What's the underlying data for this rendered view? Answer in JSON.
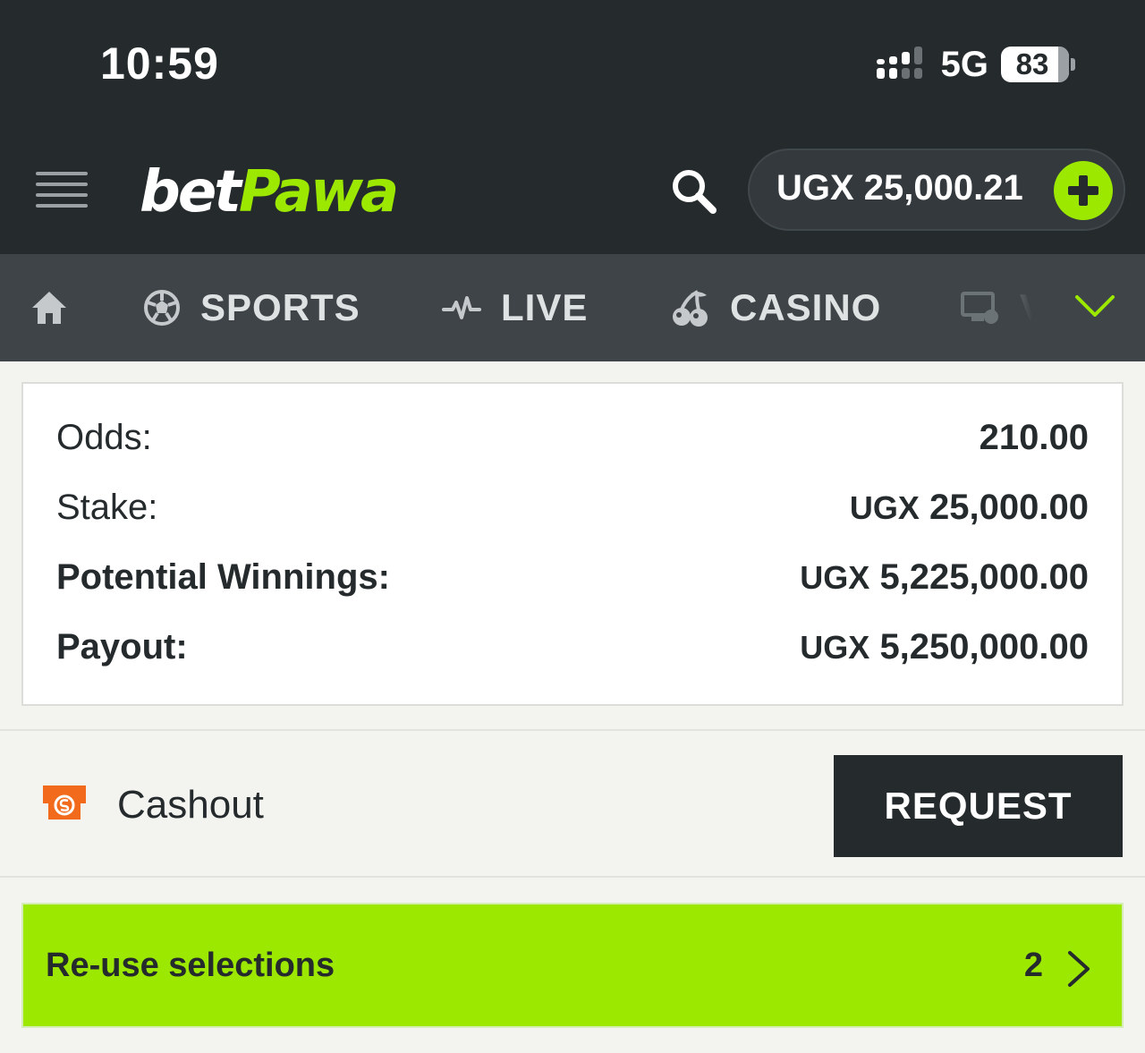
{
  "status_bar": {
    "time": "10:59",
    "network": "5G",
    "battery": "83"
  },
  "header": {
    "logo_bet": "bet",
    "logo_pawa": "Pawa",
    "balance": "UGX 25,000.21"
  },
  "nav": {
    "items": [
      {
        "label": "SPORTS",
        "icon": "soccer-ball-icon"
      },
      {
        "label": "LIVE",
        "icon": "pulse-icon"
      },
      {
        "label": "CASINO",
        "icon": "cherries-icon"
      },
      {
        "label": "V",
        "icon": "virtual-monitor-icon"
      }
    ]
  },
  "summary": {
    "odds_label": "Odds:",
    "odds_value": "210.00",
    "stake_label": "Stake:",
    "stake_currency": "UGX",
    "stake_amount": "25,000.00",
    "winnings_label": "Potential Winnings:",
    "winnings_currency": "UGX",
    "winnings_amount": "5,225,000.00",
    "payout_label": "Payout:",
    "payout_currency": "UGX",
    "payout_amount": "5,250,000.00"
  },
  "cashout": {
    "label": "Cashout",
    "button": "REQUEST"
  },
  "reuse": {
    "label": "Re-use selections",
    "count": "2"
  },
  "colors": {
    "brand_green": "#9ce800",
    "dark": "#252a2d",
    "nav_bg": "#3e4448",
    "cashout_orange": "#f26b1d"
  }
}
